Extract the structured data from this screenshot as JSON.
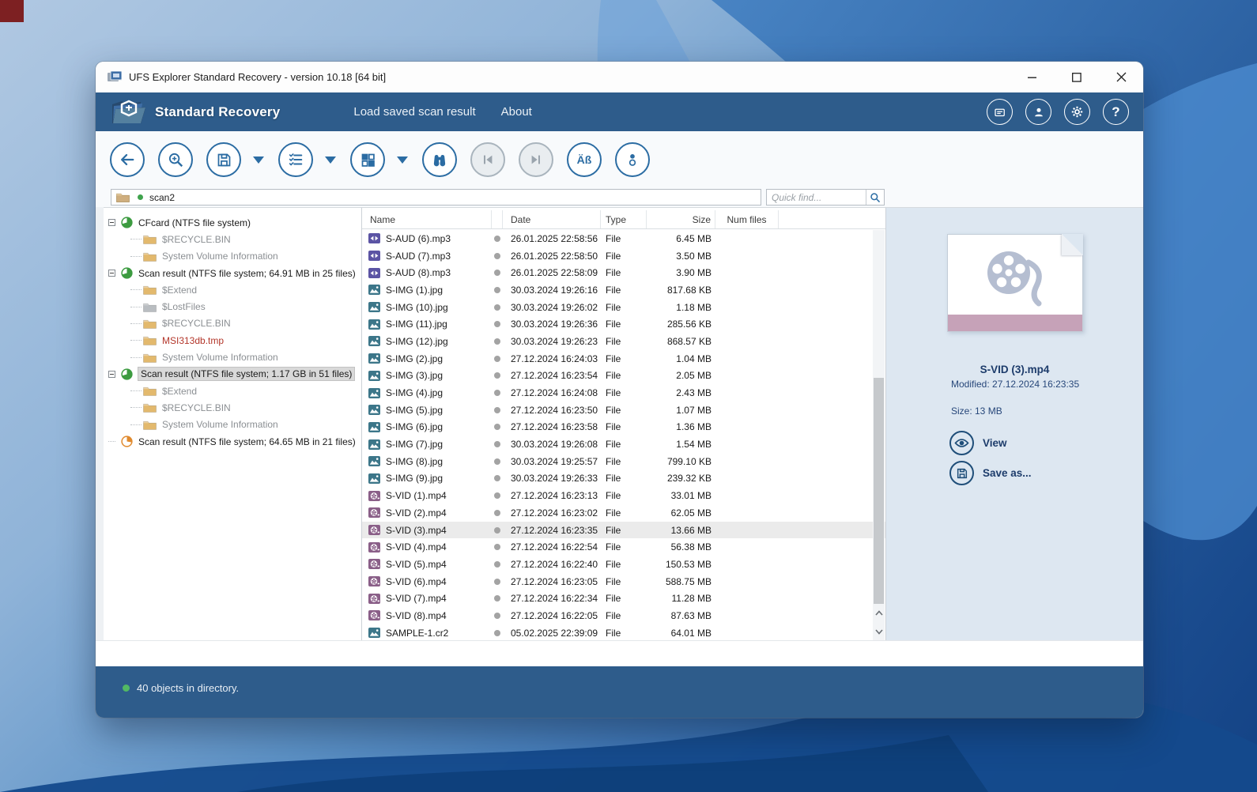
{
  "window": {
    "title": "UFS Explorer Standard Recovery - version 10.18 [64 bit]"
  },
  "header": {
    "brand": "Standard Recovery",
    "menu": [
      "Load saved scan result",
      "About"
    ],
    "icons": [
      "license-card-icon",
      "user-icon",
      "settings-gear-icon",
      "help-icon"
    ],
    "help_glyph": "?"
  },
  "toolbar": {
    "buttons": [
      "back",
      "scan-search",
      "save",
      "view-options",
      "layout",
      "find",
      "previous",
      "next",
      "encoding",
      "info"
    ],
    "encoding_label": "Äß"
  },
  "path_bar": {
    "value": "scan2"
  },
  "quick_find": {
    "placeholder": "Quick find..."
  },
  "tree": {
    "items": [
      {
        "label": "CFcard (NTFS file system)",
        "icon": "pie-green",
        "level": 0,
        "expander": true,
        "color": "dark",
        "selected": false
      },
      {
        "label": "$RECYCLE.BIN",
        "icon": "folder",
        "level": 1,
        "expander": false,
        "color": "gray",
        "selected": false
      },
      {
        "label": "System Volume Information",
        "icon": "folder",
        "level": 1,
        "expander": false,
        "color": "gray",
        "selected": false
      },
      {
        "label": "Scan result (NTFS file system; 64.91 MB in 25 files)",
        "icon": "pie-green",
        "level": 0,
        "expander": true,
        "color": "dark",
        "selected": false
      },
      {
        "label": "$Extend",
        "icon": "folder",
        "level": 1,
        "expander": false,
        "color": "gray",
        "selected": false
      },
      {
        "label": "$LostFiles",
        "icon": "folder-gray",
        "level": 1,
        "expander": false,
        "color": "gray",
        "selected": false
      },
      {
        "label": "$RECYCLE.BIN",
        "icon": "folder",
        "level": 1,
        "expander": false,
        "color": "gray",
        "selected": false
      },
      {
        "label": "MSI313db.tmp",
        "icon": "folder",
        "level": 1,
        "expander": false,
        "color": "red",
        "selected": false
      },
      {
        "label": "System Volume Information",
        "icon": "folder",
        "level": 1,
        "expander": false,
        "color": "gray",
        "selected": false
      },
      {
        "label": "Scan result (NTFS file system; 1.17 GB in 51 files)",
        "icon": "pie-green",
        "level": 0,
        "expander": true,
        "color": "dark",
        "selected": true
      },
      {
        "label": "$Extend",
        "icon": "folder",
        "level": 1,
        "expander": false,
        "color": "gray",
        "selected": false
      },
      {
        "label": "$RECYCLE.BIN",
        "icon": "folder",
        "level": 1,
        "expander": false,
        "color": "gray",
        "selected": false
      },
      {
        "label": "System Volume Information",
        "icon": "folder",
        "level": 1,
        "expander": false,
        "color": "gray",
        "selected": false
      },
      {
        "label": "Scan result (NTFS file system; 64.65 MB in 21 files)",
        "icon": "pie-orange",
        "level": 0,
        "expander": false,
        "color": "dark",
        "selected": false
      }
    ]
  },
  "table": {
    "columns": [
      "Name",
      "Date",
      "Type",
      "Size",
      "Num files"
    ],
    "rows": [
      {
        "name": "S-AUD (6).mp3",
        "icon": "mp3",
        "date": "26.01.2025 22:58:56",
        "type": "File",
        "size": "6.45 MB",
        "selected": false
      },
      {
        "name": "S-AUD (7).mp3",
        "icon": "mp3",
        "date": "26.01.2025 22:58:50",
        "type": "File",
        "size": "3.50 MB",
        "selected": false
      },
      {
        "name": "S-AUD (8).mp3",
        "icon": "mp3",
        "date": "26.01.2025 22:58:09",
        "type": "File",
        "size": "3.90 MB",
        "selected": false
      },
      {
        "name": "S-IMG (1).jpg",
        "icon": "img",
        "date": "30.03.2024 19:26:16",
        "type": "File",
        "size": "817.68 KB",
        "selected": false
      },
      {
        "name": "S-IMG (10).jpg",
        "icon": "img",
        "date": "30.03.2024 19:26:02",
        "type": "File",
        "size": "1.18 MB",
        "selected": false
      },
      {
        "name": "S-IMG (11).jpg",
        "icon": "img",
        "date": "30.03.2024 19:26:36",
        "type": "File",
        "size": "285.56 KB",
        "selected": false
      },
      {
        "name": "S-IMG (12).jpg",
        "icon": "img",
        "date": "30.03.2024 19:26:23",
        "type": "File",
        "size": "868.57 KB",
        "selected": false
      },
      {
        "name": "S-IMG (2).jpg",
        "icon": "img",
        "date": "27.12.2024 16:24:03",
        "type": "File",
        "size": "1.04 MB",
        "selected": false
      },
      {
        "name": "S-IMG (3).jpg",
        "icon": "img",
        "date": "27.12.2024 16:23:54",
        "type": "File",
        "size": "2.05 MB",
        "selected": false
      },
      {
        "name": "S-IMG (4).jpg",
        "icon": "img",
        "date": "27.12.2024 16:24:08",
        "type": "File",
        "size": "2.43 MB",
        "selected": false
      },
      {
        "name": "S-IMG (5).jpg",
        "icon": "img",
        "date": "27.12.2024 16:23:50",
        "type": "File",
        "size": "1.07 MB",
        "selected": false
      },
      {
        "name": "S-IMG (6).jpg",
        "icon": "img",
        "date": "27.12.2024 16:23:58",
        "type": "File",
        "size": "1.36 MB",
        "selected": false
      },
      {
        "name": "S-IMG (7).jpg",
        "icon": "img",
        "date": "30.03.2024 19:26:08",
        "type": "File",
        "size": "1.54 MB",
        "selected": false
      },
      {
        "name": "S-IMG (8).jpg",
        "icon": "img",
        "date": "30.03.2024 19:25:57",
        "type": "File",
        "size": "799.10 KB",
        "selected": false
      },
      {
        "name": "S-IMG (9).jpg",
        "icon": "img",
        "date": "30.03.2024 19:26:33",
        "type": "File",
        "size": "239.32 KB",
        "selected": false
      },
      {
        "name": "S-VID (1).mp4",
        "icon": "vid",
        "date": "27.12.2024 16:23:13",
        "type": "File",
        "size": "33.01 MB",
        "selected": false
      },
      {
        "name": "S-VID (2).mp4",
        "icon": "vid",
        "date": "27.12.2024 16:23:02",
        "type": "File",
        "size": "62.05 MB",
        "selected": false
      },
      {
        "name": "S-VID (3).mp4",
        "icon": "vid",
        "date": "27.12.2024 16:23:35",
        "type": "File",
        "size": "13.66 MB",
        "selected": true
      },
      {
        "name": "S-VID (4).mp4",
        "icon": "vid",
        "date": "27.12.2024 16:22:54",
        "type": "File",
        "size": "56.38 MB",
        "selected": false
      },
      {
        "name": "S-VID (5).mp4",
        "icon": "vid",
        "date": "27.12.2024 16:22:40",
        "type": "File",
        "size": "150.53 MB",
        "selected": false
      },
      {
        "name": "S-VID (6).mp4",
        "icon": "vid",
        "date": "27.12.2024 16:23:05",
        "type": "File",
        "size": "588.75 MB",
        "selected": false
      },
      {
        "name": "S-VID (7).mp4",
        "icon": "vid",
        "date": "27.12.2024 16:22:34",
        "type": "File",
        "size": "11.28 MB",
        "selected": false
      },
      {
        "name": "S-VID (8).mp4",
        "icon": "vid",
        "date": "27.12.2024 16:22:05",
        "type": "File",
        "size": "87.63 MB",
        "selected": false
      },
      {
        "name": "SAMPLE-1.cr2",
        "icon": "img",
        "date": "05.02.2025 22:39:09",
        "type": "File",
        "size": "64.01 MB",
        "selected": false
      }
    ]
  },
  "preview": {
    "file_name": "S-VID (3).mp4",
    "modified_line": "Modified: 27.12.2024 16:23:35",
    "size_line": "Size: 13 MB",
    "view_label": "View",
    "save_as_label": "Save as...",
    "icon": "video-file-icon"
  },
  "status_bar": {
    "text": "40 objects in directory."
  },
  "colors": {
    "header_blue": "#2e5c8b",
    "icon_blue": "#2b6ca3",
    "selection_gray": "#ebebeb",
    "tree_error_red": "#b3362a",
    "status_green": "#52b964",
    "preview_bg": "#dde7f1",
    "mp3_icon": "#5b54a4",
    "image_icon": "#3c7689",
    "video_icon": "#8a5f88"
  }
}
